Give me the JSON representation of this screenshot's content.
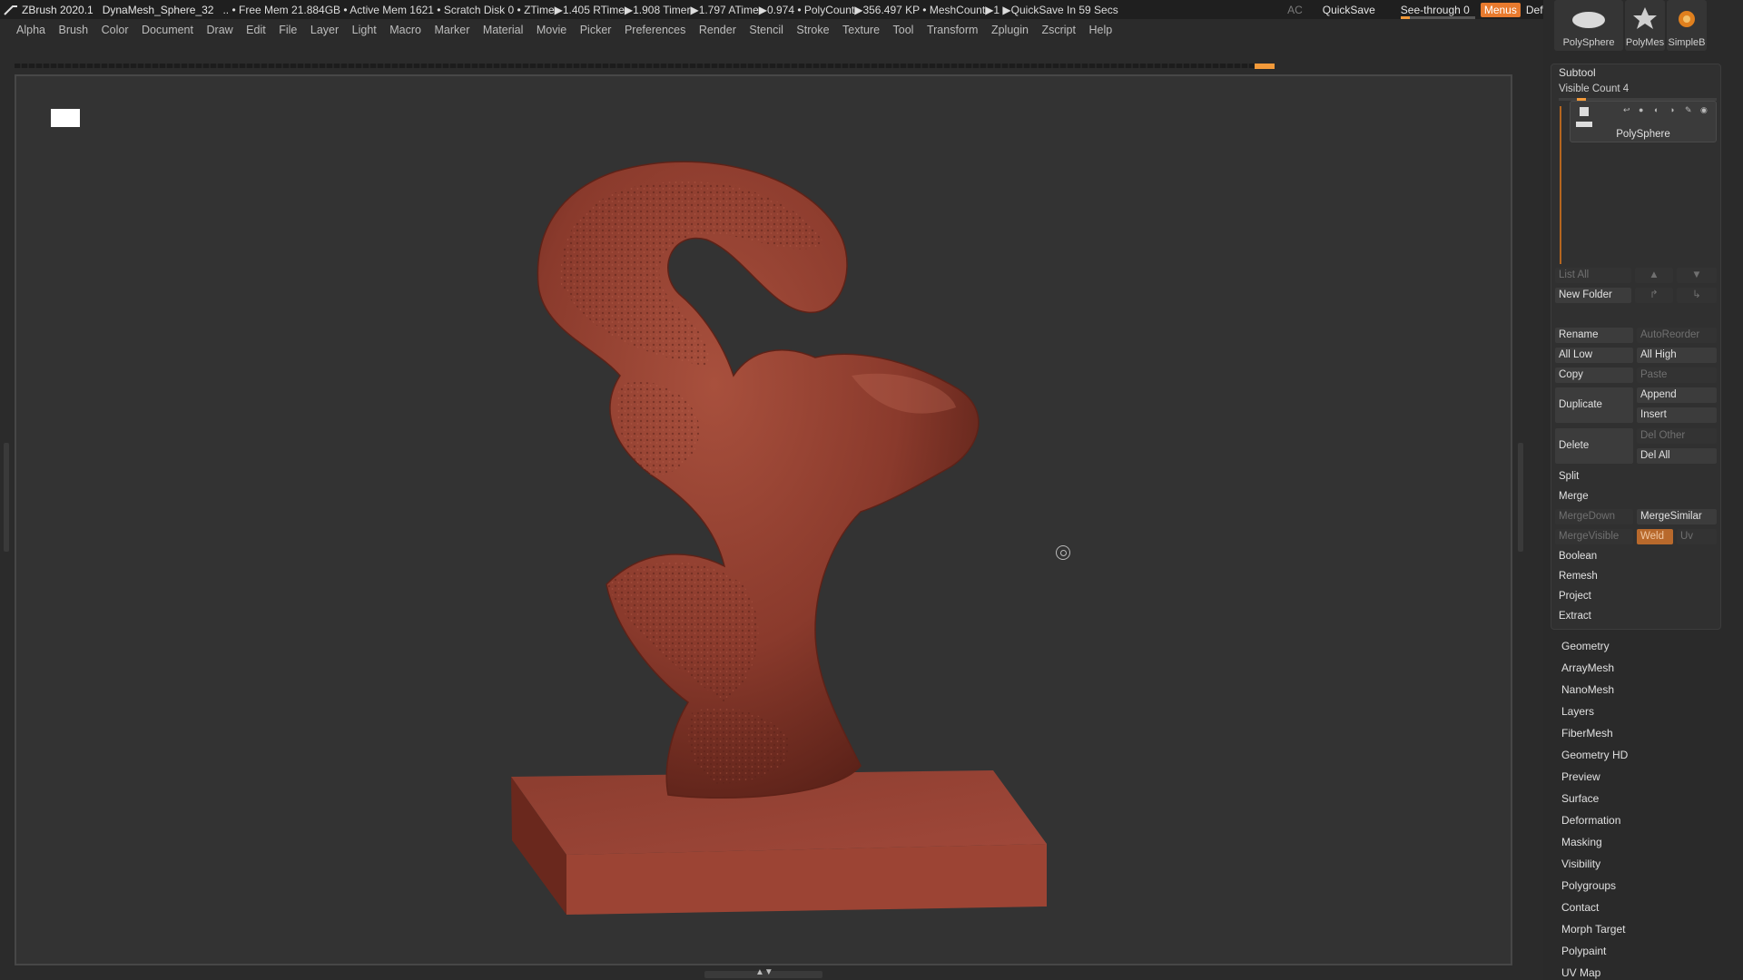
{
  "titlebar": {
    "app": "ZBrush 2020.1",
    "document": "DynaMesh_Sphere_32",
    "stats": "..  • Free Mem 21.884GB • Active Mem 1621 • Scratch Disk 0 •  ZTime▶1.405 RTime▶1.908 Timer▶1.797 ATime▶0.974 • PolyCount▶356.497 KP  • MeshCount▶1  ▶QuickSave In 59 Secs",
    "ac": "AC",
    "quicksave": "QuickSave",
    "see_through": "See-through   0",
    "see_through_value": 0,
    "menus": "Menus",
    "script": "DefaultZScript"
  },
  "menubar": {
    "items": [
      "Alpha",
      "Brush",
      "Color",
      "Document",
      "Draw",
      "Edit",
      "File",
      "Layer",
      "Light",
      "Macro",
      "Marker",
      "Material",
      "Movie",
      "Picker",
      "Preferences",
      "Render",
      "Stencil",
      "Stroke",
      "Texture",
      "Tool",
      "Transform",
      "Zplugin",
      "Zscript",
      "Help"
    ]
  },
  "viewport": {
    "background": "#333333",
    "model_color": "#8a3a2c"
  },
  "right_panel": {
    "thumbs": [
      {
        "label": "PolySphere"
      },
      {
        "label": "PolyMes"
      },
      {
        "label": "SimpleB"
      }
    ],
    "subtool": {
      "title": "Subtool",
      "visible_count": "Visible Count 4",
      "item_name": "PolySphere",
      "list_all": "List All",
      "new_folder": "New Folder",
      "rename": "Rename",
      "autoreorder": "AutoReorder",
      "all_low": "All Low",
      "all_high": "All High",
      "copy": "Copy",
      "paste": "Paste",
      "duplicate": "Duplicate",
      "append": "Append",
      "insert": "Insert",
      "delete": "Delete",
      "del_other": "Del Other",
      "del_all": "Del All",
      "split": "Split",
      "merge": "Merge",
      "mergedown": "MergeDown",
      "mergesimilar": "MergeSimilar",
      "mergevisible": "MergeVisible",
      "weld": "Weld",
      "uv": "Uv",
      "boolean": "Boolean",
      "remesh": "Remesh",
      "project": "Project",
      "extract": "Extract"
    },
    "sections": [
      "Geometry",
      "ArrayMesh",
      "NanoMesh",
      "Layers",
      "FiberMesh",
      "Geometry HD",
      "Preview",
      "Surface",
      "Deformation",
      "Masking",
      "Visibility",
      "Polygroups",
      "Contact",
      "Morph Target",
      "Polypaint",
      "UV Map"
    ]
  },
  "colors": {
    "accent": "#f39a3a",
    "menus_highlight": "#e87a2e"
  }
}
